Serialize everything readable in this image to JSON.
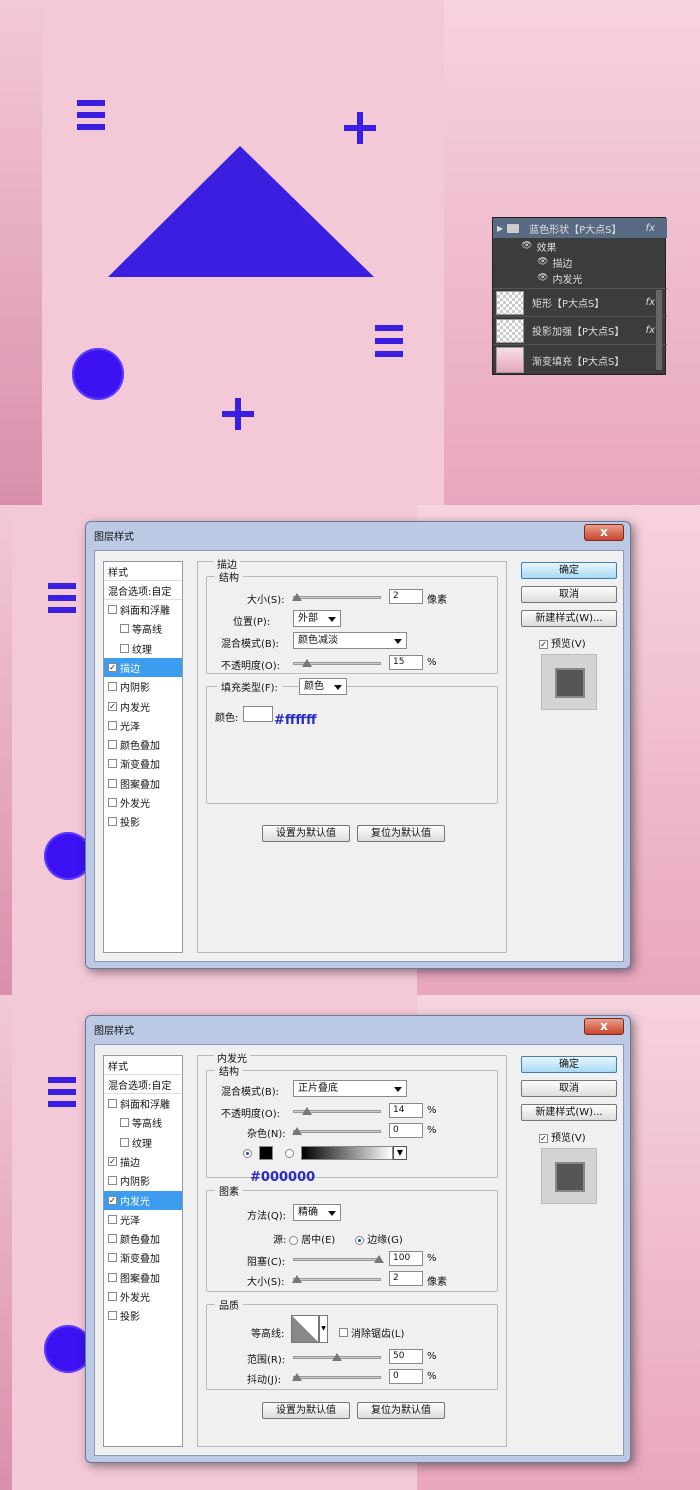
{
  "layers": {
    "group_name": "蓝色形状【P大点S】",
    "fx": "fx",
    "effects_label": "效果",
    "effect1": "描边",
    "effect2": "内发光",
    "layer1": "矩形【P大点S】",
    "layer2": "投影加强【P大点S】",
    "layer3": "渐变填充【P大点S】"
  },
  "dialog1": {
    "title": "图层样式",
    "close": "x",
    "style_list": {
      "header": "样式",
      "blend": "混合选项:自定",
      "items": [
        {
          "label": "斜面和浮雕",
          "checked": false
        },
        {
          "label": "等高线",
          "checked": false
        },
        {
          "label": "纹理",
          "checked": false
        },
        {
          "label": "描边",
          "checked": true
        },
        {
          "label": "内阴影",
          "checked": false
        },
        {
          "label": "内发光",
          "checked": true
        },
        {
          "label": "光泽",
          "checked": false
        },
        {
          "label": "颜色叠加",
          "checked": false
        },
        {
          "label": "渐变叠加",
          "checked": false
        },
        {
          "label": "图案叠加",
          "checked": false
        },
        {
          "label": "外发光",
          "checked": false
        },
        {
          "label": "投影",
          "checked": false
        }
      ],
      "selected": "描边"
    },
    "section": "描边",
    "group_struct": "结构",
    "size_label": "大小(S):",
    "size_value": "2",
    "size_unit": "像素",
    "position_label": "位置(P):",
    "position_value": "外部",
    "blend_label": "混合模式(B):",
    "blend_value": "颜色减淡",
    "opacity_label": "不透明度(O):",
    "opacity_value": "15",
    "percent": "%",
    "fill_type_label": "填充类型(F):",
    "fill_type_value": "颜色",
    "color_label": "颜色:",
    "color_annotation": "#ffffff",
    "btn_default": "设置为默认值",
    "btn_reset": "复位为默认值",
    "ok": "确定",
    "cancel": "取消",
    "new_style": "新建样式(W)...",
    "preview": "预览(V)"
  },
  "dialog2": {
    "title": "图层样式",
    "close": "x",
    "style_list": {
      "header": "样式",
      "blend": "混合选项:自定",
      "selected": "内发光"
    },
    "section": "内发光",
    "group_struct": "结构",
    "blend_label": "混合模式(B):",
    "blend_value": "正片叠底",
    "opacity_label": "不透明度(O):",
    "opacity_value": "14",
    "noise_label": "杂色(N):",
    "noise_value": "0",
    "percent": "%",
    "color_annotation": "#000000",
    "group_elements": "图素",
    "method_label": "方法(Q):",
    "method_value": "精确",
    "source_label": "源:",
    "source_center": "居中(E)",
    "source_edge": "边缘(G)",
    "choke_label": "阻塞(C):",
    "choke_value": "100",
    "size_label": "大小(S):",
    "size_value": "2",
    "size_unit": "像素",
    "group_quality": "品质",
    "contour_label": "等高线:",
    "antialias_label": "消除锯齿(L)",
    "range_label": "范围(R):",
    "range_value": "50",
    "jitter_label": "抖动(J):",
    "jitter_value": "0",
    "btn_default": "设置为默认值",
    "btn_reset": "复位为默认值",
    "ok": "确定",
    "cancel": "取消",
    "new_style": "新建样式(W)...",
    "preview": "预览(V)"
  },
  "colors": {
    "shape_blue": "#3a1fe0",
    "canvas_pink": "#f4c9d7",
    "selection_blue": "#3b9cf0"
  }
}
